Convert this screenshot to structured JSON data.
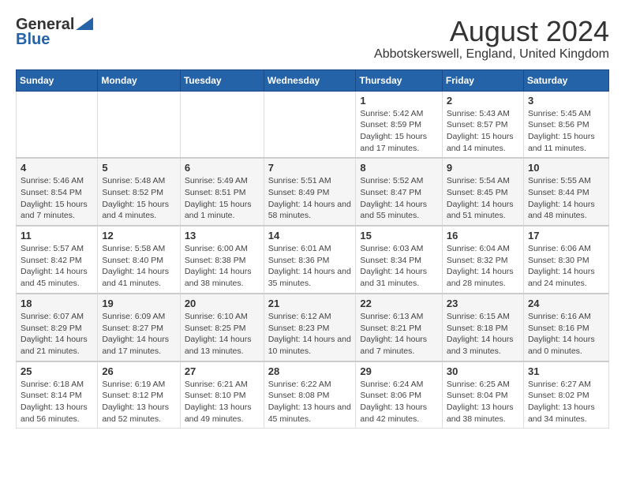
{
  "logo": {
    "general": "General",
    "blue": "Blue"
  },
  "header": {
    "month_year": "August 2024",
    "location": "Abbotskerswell, England, United Kingdom"
  },
  "weekdays": [
    "Sunday",
    "Monday",
    "Tuesday",
    "Wednesday",
    "Thursday",
    "Friday",
    "Saturday"
  ],
  "weeks": [
    {
      "days": [
        {
          "num": "",
          "info": ""
        },
        {
          "num": "",
          "info": ""
        },
        {
          "num": "",
          "info": ""
        },
        {
          "num": "",
          "info": ""
        },
        {
          "num": "1",
          "info": "Sunrise: 5:42 AM\nSunset: 8:59 PM\nDaylight: 15 hours and 17 minutes."
        },
        {
          "num": "2",
          "info": "Sunrise: 5:43 AM\nSunset: 8:57 PM\nDaylight: 15 hours and 14 minutes."
        },
        {
          "num": "3",
          "info": "Sunrise: 5:45 AM\nSunset: 8:56 PM\nDaylight: 15 hours and 11 minutes."
        }
      ]
    },
    {
      "days": [
        {
          "num": "4",
          "info": "Sunrise: 5:46 AM\nSunset: 8:54 PM\nDaylight: 15 hours and 7 minutes."
        },
        {
          "num": "5",
          "info": "Sunrise: 5:48 AM\nSunset: 8:52 PM\nDaylight: 15 hours and 4 minutes."
        },
        {
          "num": "6",
          "info": "Sunrise: 5:49 AM\nSunset: 8:51 PM\nDaylight: 15 hours and 1 minute."
        },
        {
          "num": "7",
          "info": "Sunrise: 5:51 AM\nSunset: 8:49 PM\nDaylight: 14 hours and 58 minutes."
        },
        {
          "num": "8",
          "info": "Sunrise: 5:52 AM\nSunset: 8:47 PM\nDaylight: 14 hours and 55 minutes."
        },
        {
          "num": "9",
          "info": "Sunrise: 5:54 AM\nSunset: 8:45 PM\nDaylight: 14 hours and 51 minutes."
        },
        {
          "num": "10",
          "info": "Sunrise: 5:55 AM\nSunset: 8:44 PM\nDaylight: 14 hours and 48 minutes."
        }
      ]
    },
    {
      "days": [
        {
          "num": "11",
          "info": "Sunrise: 5:57 AM\nSunset: 8:42 PM\nDaylight: 14 hours and 45 minutes."
        },
        {
          "num": "12",
          "info": "Sunrise: 5:58 AM\nSunset: 8:40 PM\nDaylight: 14 hours and 41 minutes."
        },
        {
          "num": "13",
          "info": "Sunrise: 6:00 AM\nSunset: 8:38 PM\nDaylight: 14 hours and 38 minutes."
        },
        {
          "num": "14",
          "info": "Sunrise: 6:01 AM\nSunset: 8:36 PM\nDaylight: 14 hours and 35 minutes."
        },
        {
          "num": "15",
          "info": "Sunrise: 6:03 AM\nSunset: 8:34 PM\nDaylight: 14 hours and 31 minutes."
        },
        {
          "num": "16",
          "info": "Sunrise: 6:04 AM\nSunset: 8:32 PM\nDaylight: 14 hours and 28 minutes."
        },
        {
          "num": "17",
          "info": "Sunrise: 6:06 AM\nSunset: 8:30 PM\nDaylight: 14 hours and 24 minutes."
        }
      ]
    },
    {
      "days": [
        {
          "num": "18",
          "info": "Sunrise: 6:07 AM\nSunset: 8:29 PM\nDaylight: 14 hours and 21 minutes."
        },
        {
          "num": "19",
          "info": "Sunrise: 6:09 AM\nSunset: 8:27 PM\nDaylight: 14 hours and 17 minutes."
        },
        {
          "num": "20",
          "info": "Sunrise: 6:10 AM\nSunset: 8:25 PM\nDaylight: 14 hours and 13 minutes."
        },
        {
          "num": "21",
          "info": "Sunrise: 6:12 AM\nSunset: 8:23 PM\nDaylight: 14 hours and 10 minutes."
        },
        {
          "num": "22",
          "info": "Sunrise: 6:13 AM\nSunset: 8:21 PM\nDaylight: 14 hours and 7 minutes."
        },
        {
          "num": "23",
          "info": "Sunrise: 6:15 AM\nSunset: 8:18 PM\nDaylight: 14 hours and 3 minutes."
        },
        {
          "num": "24",
          "info": "Sunrise: 6:16 AM\nSunset: 8:16 PM\nDaylight: 14 hours and 0 minutes."
        }
      ]
    },
    {
      "days": [
        {
          "num": "25",
          "info": "Sunrise: 6:18 AM\nSunset: 8:14 PM\nDaylight: 13 hours and 56 minutes."
        },
        {
          "num": "26",
          "info": "Sunrise: 6:19 AM\nSunset: 8:12 PM\nDaylight: 13 hours and 52 minutes."
        },
        {
          "num": "27",
          "info": "Sunrise: 6:21 AM\nSunset: 8:10 PM\nDaylight: 13 hours and 49 minutes."
        },
        {
          "num": "28",
          "info": "Sunrise: 6:22 AM\nSunset: 8:08 PM\nDaylight: 13 hours and 45 minutes."
        },
        {
          "num": "29",
          "info": "Sunrise: 6:24 AM\nSunset: 8:06 PM\nDaylight: 13 hours and 42 minutes."
        },
        {
          "num": "30",
          "info": "Sunrise: 6:25 AM\nSunset: 8:04 PM\nDaylight: 13 hours and 38 minutes."
        },
        {
          "num": "31",
          "info": "Sunrise: 6:27 AM\nSunset: 8:02 PM\nDaylight: 13 hours and 34 minutes."
        }
      ]
    }
  ]
}
